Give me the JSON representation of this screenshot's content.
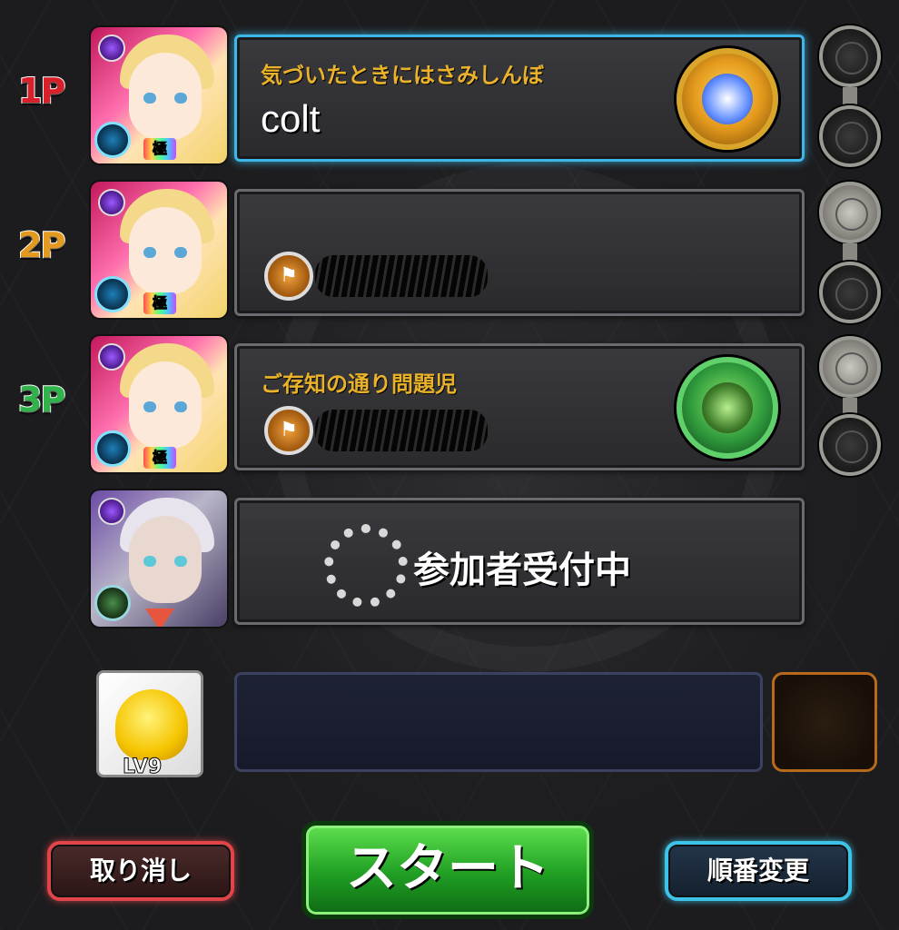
{
  "players": [
    {
      "label": "1P",
      "label_color": "#d8202b",
      "subtitle": "気づいたときにはさみしんぼ",
      "name": "colt",
      "guild_icon": "",
      "medal": "gold",
      "active": true,
      "slot_icon": "slot-empty-icon"
    },
    {
      "label": "2P",
      "label_color": "#e39a1e",
      "subtitle": "",
      "name": "",
      "guild_icon": "guild-icon",
      "medal": "",
      "active": false,
      "slot_icon": "slot-silver-icon"
    },
    {
      "label": "3P",
      "label_color": "#2fb34a",
      "subtitle": "ご存知の通り問題児",
      "name": "",
      "guild_icon": "guild-icon",
      "medal": "green",
      "active": false,
      "slot_icon": "slot-silver-icon"
    }
  ],
  "waiting": {
    "text": "参加者受付中"
  },
  "helper": {
    "level": "LV9"
  },
  "buttons": {
    "cancel": "取り消し",
    "start": "スタート",
    "reorder": "順番変更"
  },
  "colors": {
    "active_border": "#3fb6e8",
    "subtitle": "#e9b22a",
    "start_green": "#1f9e23",
    "cancel_red": "#e1454a",
    "reorder_blue": "#3ec3e8"
  }
}
